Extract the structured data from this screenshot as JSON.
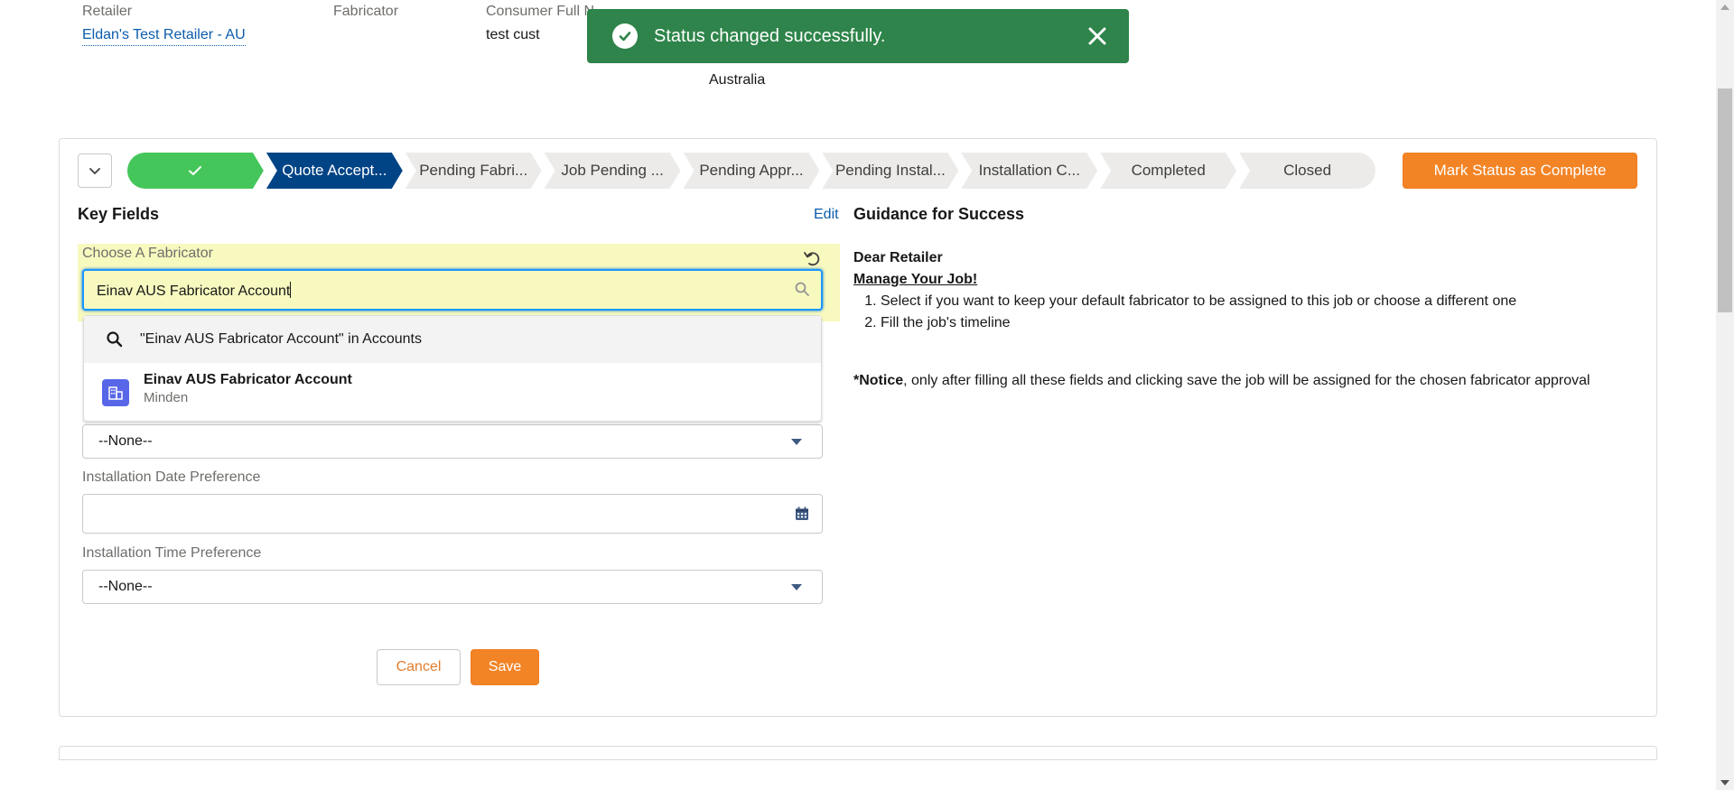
{
  "highlights": {
    "retailer_label": "Retailer",
    "retailer_value": "Eldan's Test Retailer - AU",
    "fabricator_label": "Fabricator",
    "consumer_label": "Consumer Full N",
    "consumer_value": "test cust",
    "address_country": "Australia"
  },
  "toast": {
    "message": "Status changed successfully.",
    "color": "#2e844a"
  },
  "path": {
    "stages": [
      {
        "label": "",
        "state": "complete"
      },
      {
        "label": "Quote Accept...",
        "state": "current"
      },
      {
        "label": "Pending Fabri...",
        "state": "incomplete"
      },
      {
        "label": "Job Pending ...",
        "state": "incomplete"
      },
      {
        "label": "Pending Appr...",
        "state": "incomplete"
      },
      {
        "label": "Pending Instal...",
        "state": "incomplete"
      },
      {
        "label": "Installation C...",
        "state": "incomplete"
      },
      {
        "label": "Completed",
        "state": "incomplete"
      },
      {
        "label": "Closed",
        "state": "incomplete"
      }
    ],
    "mark_button": "Mark Status as Complete"
  },
  "key_fields": {
    "title": "Key Fields",
    "edit": "Edit",
    "choose_label": "Choose A Fabricator",
    "lookup_value": "Einav AUS Fabricator Account",
    "dropdown": {
      "search_text": "\"Einav AUS Fabricator Account\" in Accounts",
      "result_name": "Einav AUS Fabricator Account",
      "result_sub": "Minden"
    },
    "select1_value": "--None--",
    "install_date_label": "Installation Date Preference",
    "install_date_value": "",
    "install_time_label": "Installation Time Preference",
    "select2_value": "--None--",
    "cancel": "Cancel",
    "save": "Save"
  },
  "guidance": {
    "title": "Guidance for Success",
    "greeting": "Dear Retailer",
    "subtitle": "Manage Your Job!",
    "steps": [
      "Select if you want to keep your default fabricator to be assigned to this job or choose a different one",
      "Fill the job's timeline"
    ],
    "notice_bold": "*Notice",
    "notice_text": ", only after filling all these fields and clicking save the job will be assigned for the chosen fabricator approval"
  },
  "colors": {
    "accent_orange": "#f38426",
    "path_current": "#014486",
    "path_complete": "#45c65a",
    "link_blue": "#0b5cab"
  }
}
